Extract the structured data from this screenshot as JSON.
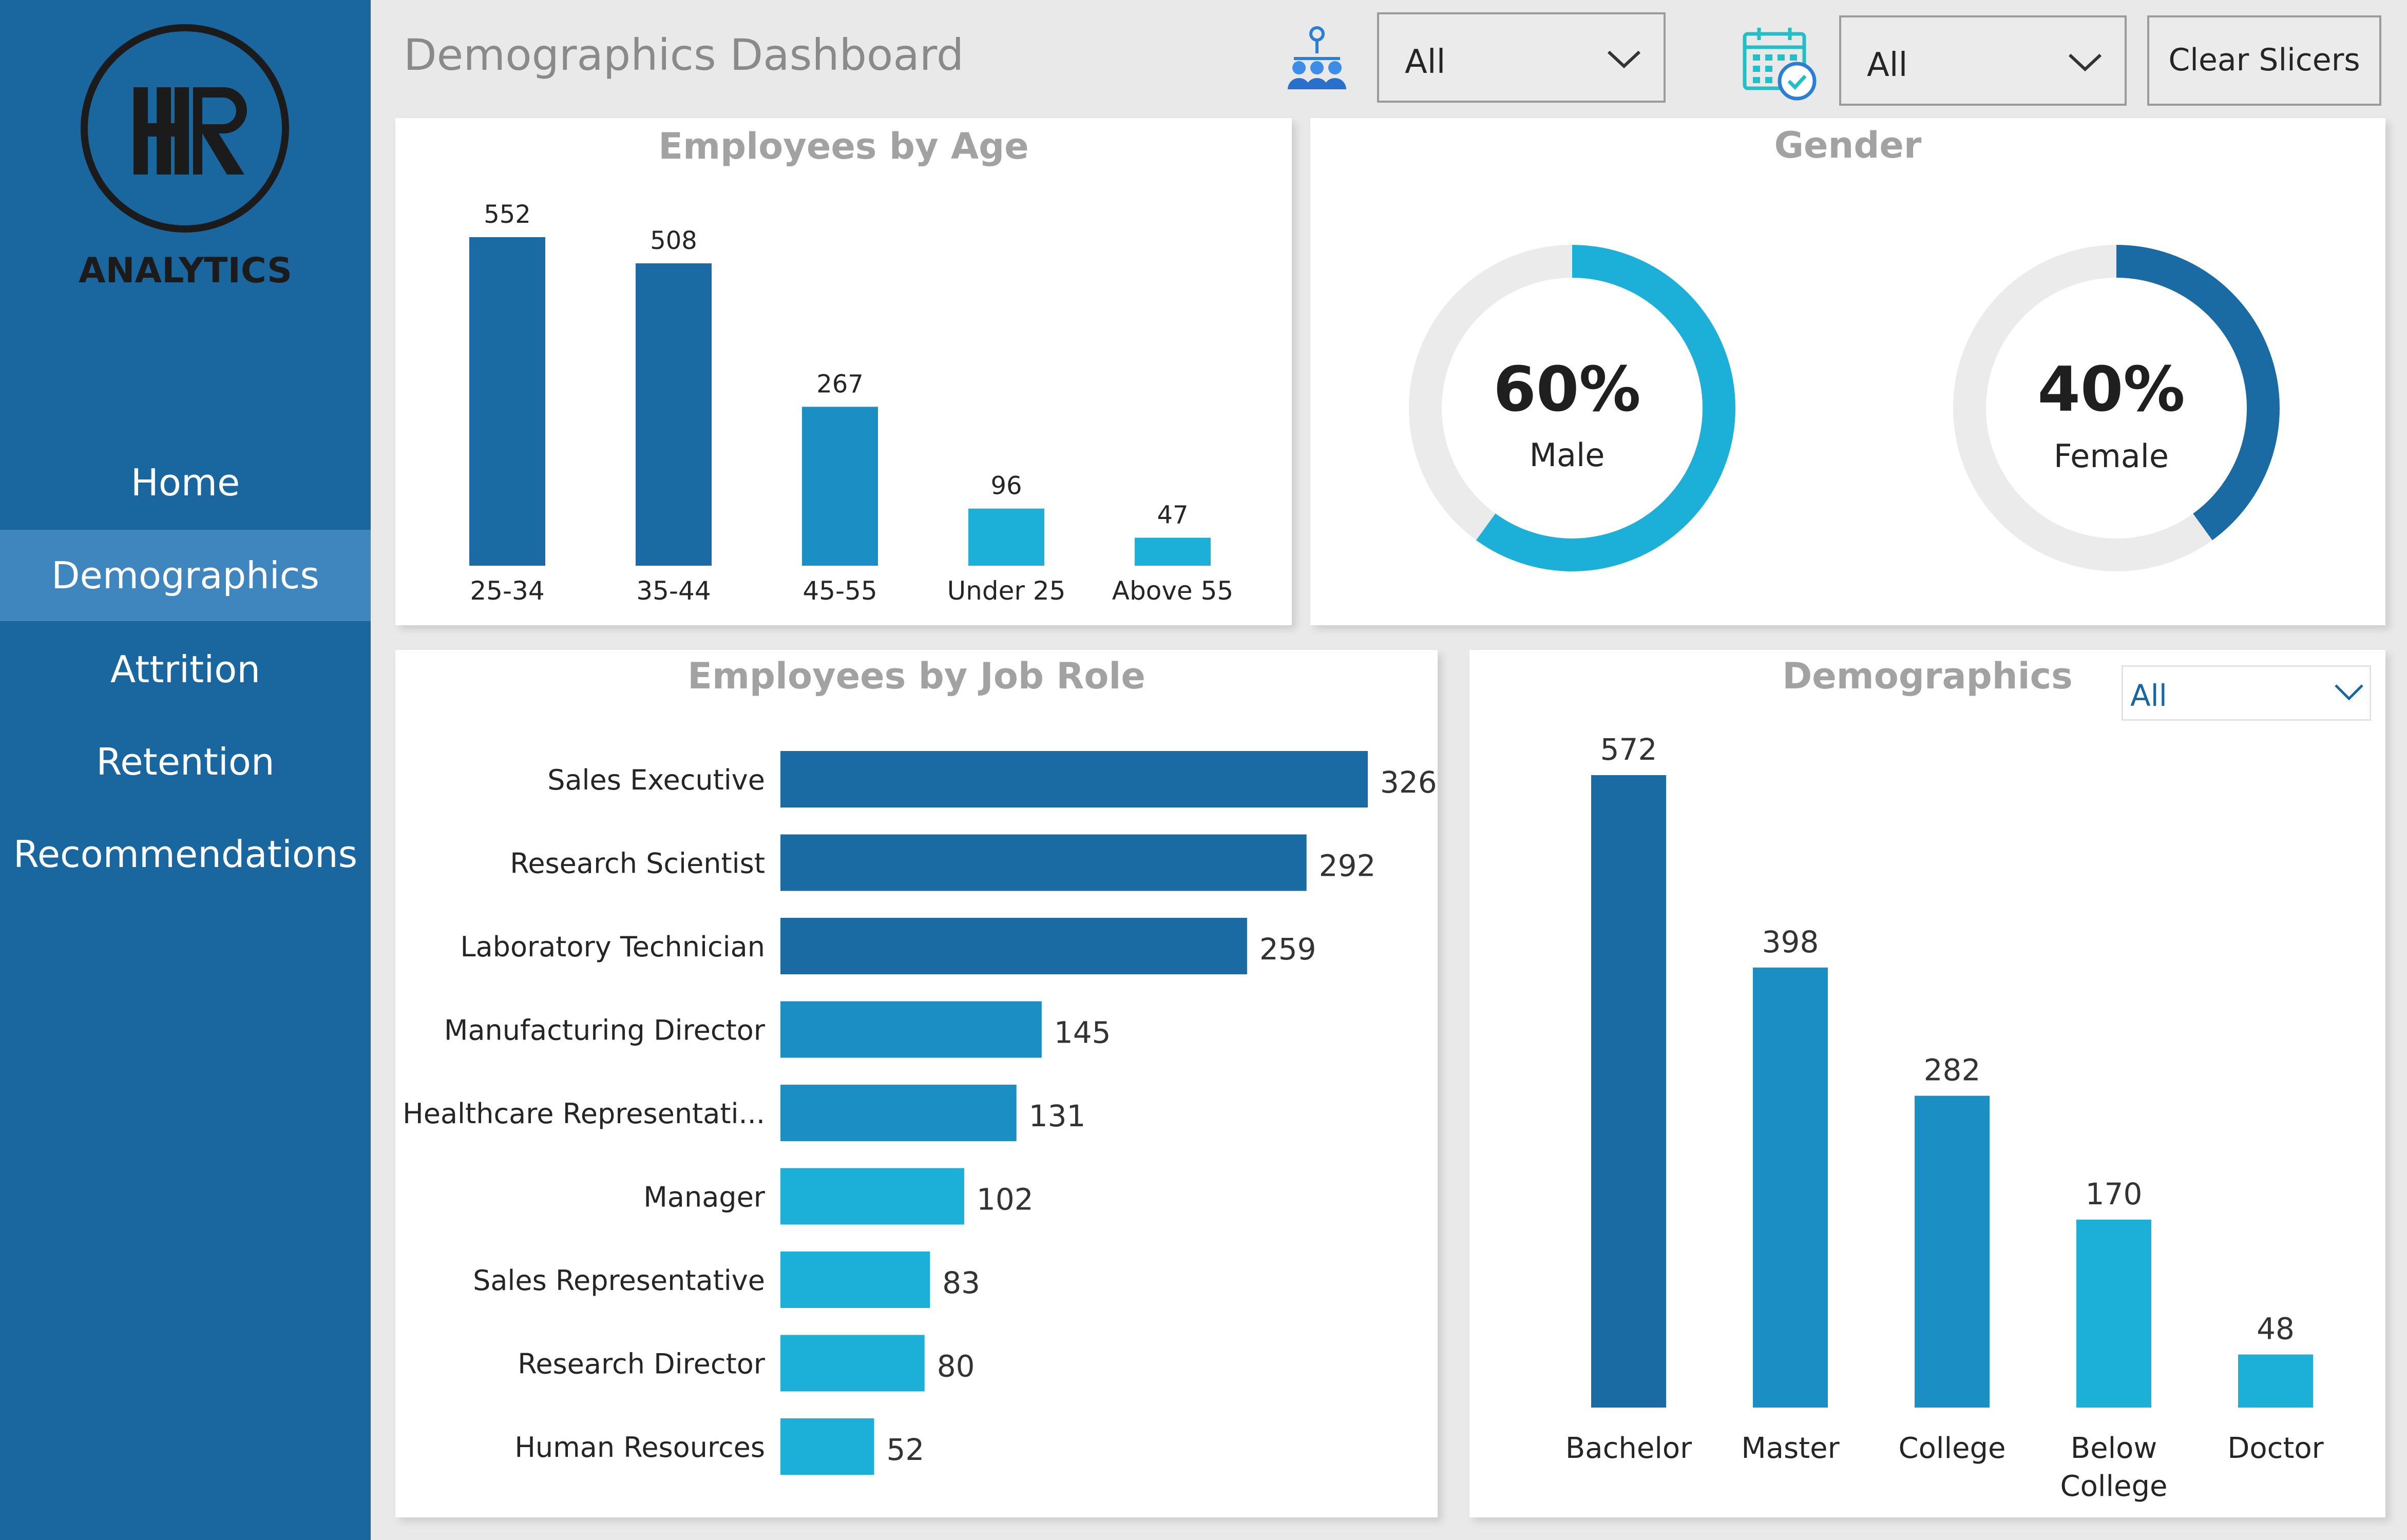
{
  "logo": {
    "text": "ANALYTICS",
    "mark": "HR"
  },
  "sidebar": {
    "items": [
      {
        "label": "Home"
      },
      {
        "label": "Demographics"
      },
      {
        "label": "Attrition"
      },
      {
        "label": "Retention"
      },
      {
        "label": "Recommendations"
      }
    ],
    "active": "Demographics"
  },
  "header": {
    "title": "Demographics Dashboard",
    "slicer1": {
      "icon": "people-icon",
      "value": "All"
    },
    "slicer2": {
      "icon": "calendar-icon",
      "value": "All"
    },
    "clear_label": "Clear Slicers"
  },
  "colors": {
    "sidebar": "#1a67a0",
    "dark_blue": "#1a6ba3",
    "mid_blue": "#1b8fc3",
    "light_blue": "#1cb0d8",
    "track": "#ebebeb"
  },
  "panels": {
    "age": {
      "title": "Employees by Age"
    },
    "gender": {
      "title": "Gender",
      "male": {
        "pct": "60%",
        "label": "Male",
        "value": 0.6
      },
      "female": {
        "pct": "40%",
        "label": "Female",
        "value": 0.4
      }
    },
    "job": {
      "title": "Employees by Job Role"
    },
    "education": {
      "title": "Demographics",
      "filter_value": "All"
    }
  },
  "chart_data": [
    {
      "type": "bar",
      "title": "Employees by Age",
      "categories": [
        "25-34",
        "35-44",
        "45-55",
        "Under 25",
        "Above 55"
      ],
      "values": [
        552,
        508,
        267,
        96,
        47
      ]
    },
    {
      "type": "pie",
      "title": "Gender",
      "categories": [
        "Male",
        "Female"
      ],
      "values": [
        60,
        40
      ]
    },
    {
      "type": "bar",
      "orientation": "horizontal",
      "title": "Employees by Job Role",
      "categories": [
        "Sales Executive",
        "Research Scientist",
        "Laboratory Technician",
        "Manufacturing Director",
        "Healthcare Representati...",
        "Manager",
        "Sales Representative",
        "Research Director",
        "Human Resources"
      ],
      "values": [
        326,
        292,
        259,
        145,
        131,
        102,
        83,
        80,
        52
      ]
    },
    {
      "type": "bar",
      "title": "Demographics",
      "categories": [
        "Bachelor",
        "Master",
        "College",
        "Below College",
        "Doctor"
      ],
      "values": [
        572,
        398,
        282,
        170,
        48
      ]
    }
  ]
}
